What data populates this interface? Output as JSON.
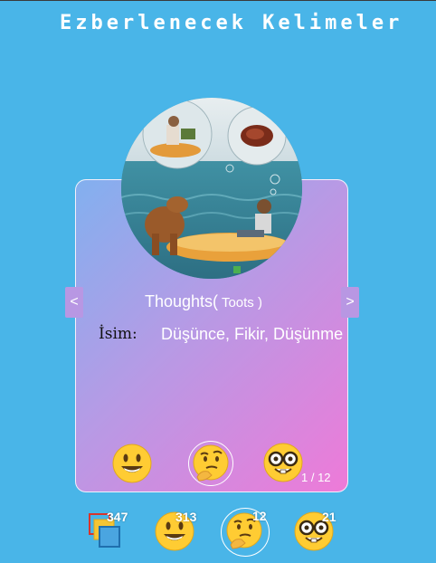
{
  "app": {
    "title": "Ezberlenecek Kelimeler"
  },
  "card": {
    "image_description_icon": "word-illustration-image",
    "prev_label": "<",
    "next_label": ">",
    "word": "Thoughts(",
    "pronunciation": " Toots )",
    "meaning_label": "İsim:",
    "meaning": "Düşünce, Fikir, Düşünme",
    "page_current": "1",
    "page_separator": " / ",
    "page_total": "12",
    "rating_icons": [
      "smiley-icon",
      "thinking-icon",
      "nerd-icon"
    ],
    "selected_rating": "thinking-icon"
  },
  "stats": {
    "all": {
      "icon": "cards-stack-icon",
      "count": "347"
    },
    "known": {
      "icon": "smiley-icon",
      "count": "313"
    },
    "thinking": {
      "icon": "thinking-icon",
      "count": "12"
    },
    "learned": {
      "icon": "nerd-icon",
      "count": "21"
    },
    "selected": "thinking"
  },
  "colors": {
    "background": "#49b5e8",
    "card_gradient_start": "#82b0ef",
    "card_gradient_end": "#ee7ad8",
    "nav_button": "#b897e3"
  }
}
